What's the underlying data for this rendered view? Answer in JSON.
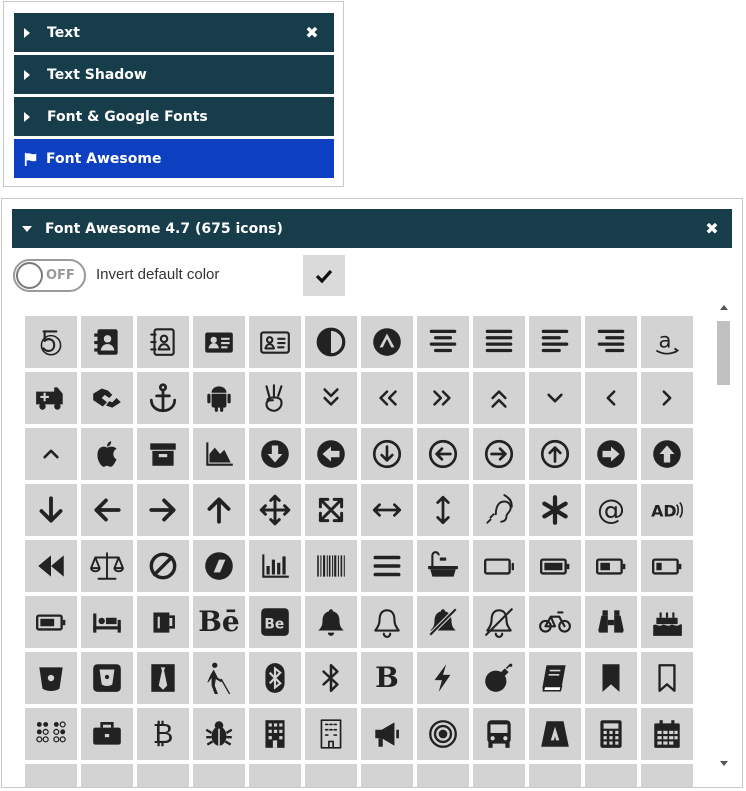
{
  "accordion": {
    "items": [
      {
        "label": "Text",
        "has_close": true
      },
      {
        "label": "Text Shadow"
      },
      {
        "label": "Font & Google Fonts"
      },
      {
        "label": "Font Awesome",
        "active": true
      }
    ],
    "active_color": "#0c40c0",
    "bar_color": "#173d4a"
  },
  "fa_panel": {
    "title": "Font Awesome 4.7 (675 icons)",
    "close_icon": "close-icon",
    "toggle_state": "OFF",
    "invert_label": "Invert default color",
    "check_icon": "check-icon"
  },
  "icons": [
    "500px",
    "address-book",
    "address-book-o",
    "address-card",
    "address-card-o",
    "adjust",
    "adn",
    "align-center",
    "align-justify",
    "align-left",
    "align-right",
    "amazon",
    "ambulance",
    "american-sign-language-interpreting",
    "anchor",
    "android",
    "angellist",
    "angle-double-down",
    "angle-double-left",
    "angle-double-right",
    "angle-double-up",
    "angle-down",
    "angle-left",
    "angle-right",
    "angle-up",
    "apple",
    "archive",
    "area-chart",
    "arrow-circle-down",
    "arrow-circle-left",
    "arrow-circle-o-down",
    "arrow-circle-o-left",
    "arrow-circle-o-right",
    "arrow-circle-o-up",
    "arrow-circle-right",
    "arrow-circle-up",
    "arrow-down",
    "arrow-left",
    "arrow-right",
    "arrow-up",
    "arrows",
    "arrows-alt",
    "arrows-h",
    "arrows-v",
    "assistive-listening-systems",
    "asterisk",
    "at",
    "audio-description",
    "backward",
    "balance-scale",
    "ban",
    "bandcamp",
    "bar-chart",
    "barcode",
    "bars",
    "bath",
    "battery-empty",
    "battery-full",
    "battery-half",
    "battery-quarter",
    "battery-three-quarters",
    "bed",
    "beer",
    "behance",
    "behance-square",
    "bell",
    "bell-o",
    "bell-slash",
    "bell-slash-o",
    "bicycle",
    "binoculars",
    "birthday-cake",
    "bitbucket",
    "bitbucket-square",
    "black-tie",
    "blind",
    "bluetooth",
    "bluetooth-b",
    "bold",
    "bolt",
    "bomb",
    "book",
    "bookmark",
    "bookmark-o",
    "braille",
    "briefcase",
    "btc",
    "bug",
    "building",
    "building-o",
    "bullhorn",
    "bullseye",
    "bus",
    "buysellads",
    "calculator",
    "calendar"
  ]
}
